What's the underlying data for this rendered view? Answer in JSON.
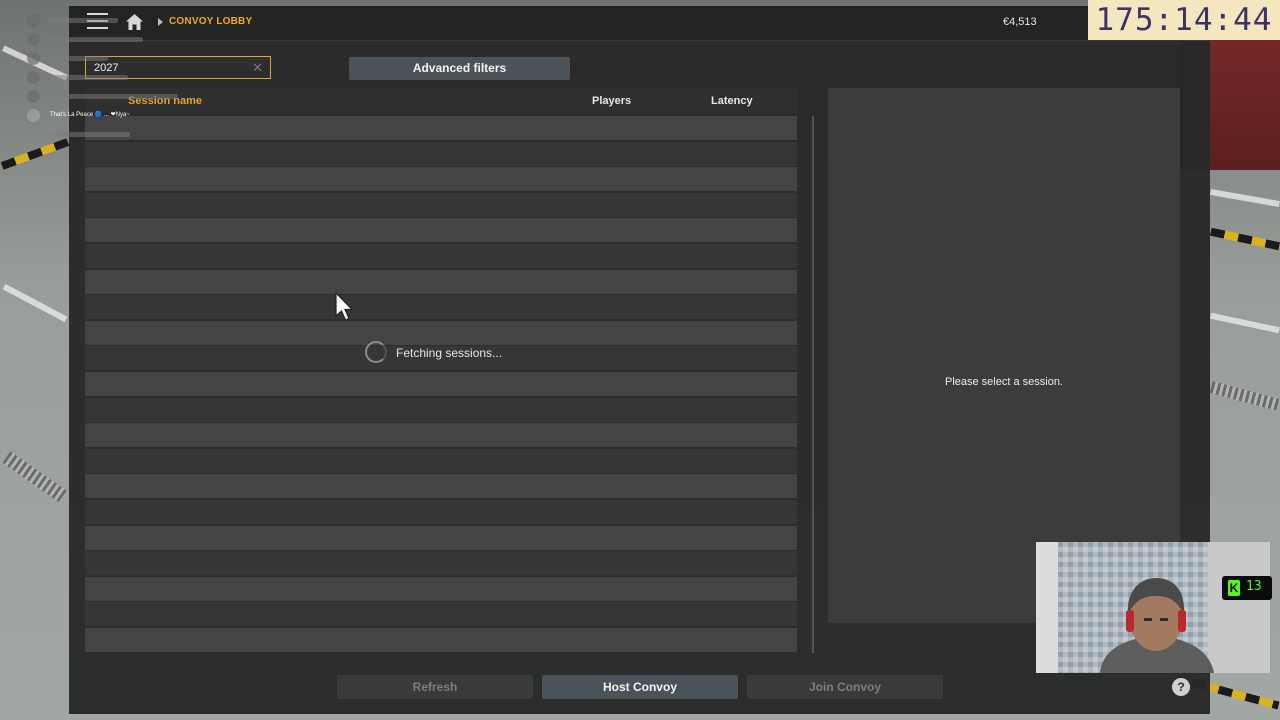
{
  "header": {
    "breadcrumb": "CONVOY LOBBY",
    "money": "€4,513",
    "timer": "175:14:44"
  },
  "search": {
    "value": "2027",
    "clear_glyph": "✕"
  },
  "filters": {
    "advanced_label": "Advanced filters"
  },
  "table": {
    "columns": {
      "name": "Session name",
      "players": "Players",
      "latency": "Latency"
    },
    "loading_text": "Fetching sessions...",
    "row_count": 21
  },
  "detail": {
    "empty_message": "Please select a session."
  },
  "footer": {
    "refresh": "Refresh",
    "host": "Host Convoy",
    "join": "Join Convoy",
    "help": "?"
  },
  "chat": {
    "visible_line": "That's La Peace 🔵 ...  ❤Nya~"
  },
  "stream_badge": {
    "icon": "K",
    "count": "13"
  },
  "colors": {
    "accent": "#e0a331",
    "panel": "#282828",
    "button_active": "#4b5359",
    "timer_bg": "#f4e6bf",
    "timer_text": "#3c3466",
    "badge_green": "#53fc18"
  },
  "icons": [
    "menu-icon",
    "home-icon",
    "breadcrumb-arrow-icon",
    "clear-icon",
    "spinner-icon",
    "help-icon",
    "mouse-cursor-icon"
  ]
}
